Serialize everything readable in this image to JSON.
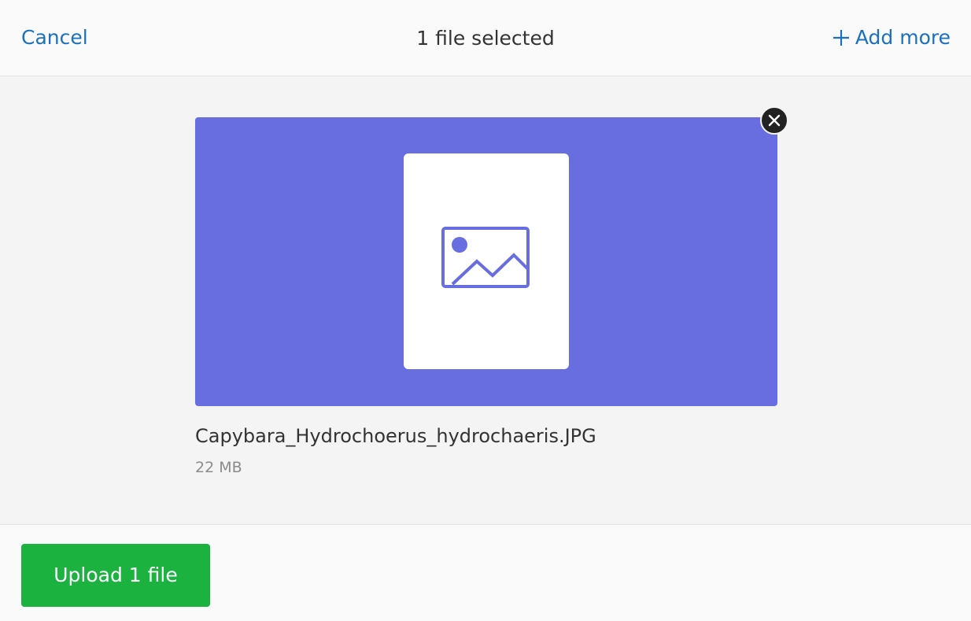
{
  "header": {
    "cancel_label": "Cancel",
    "title": "1 file selected",
    "add_more_label": "Add more"
  },
  "file": {
    "name": "Capybara_Hydrochoerus_hydrochaeris.JPG",
    "size": "22 MB",
    "preview_icon": "image-icon",
    "preview_color": "#686ee0"
  },
  "footer": {
    "upload_label": "Upload 1 file"
  },
  "colors": {
    "link": "#1b70c0",
    "upload_button": "#1bb240"
  }
}
